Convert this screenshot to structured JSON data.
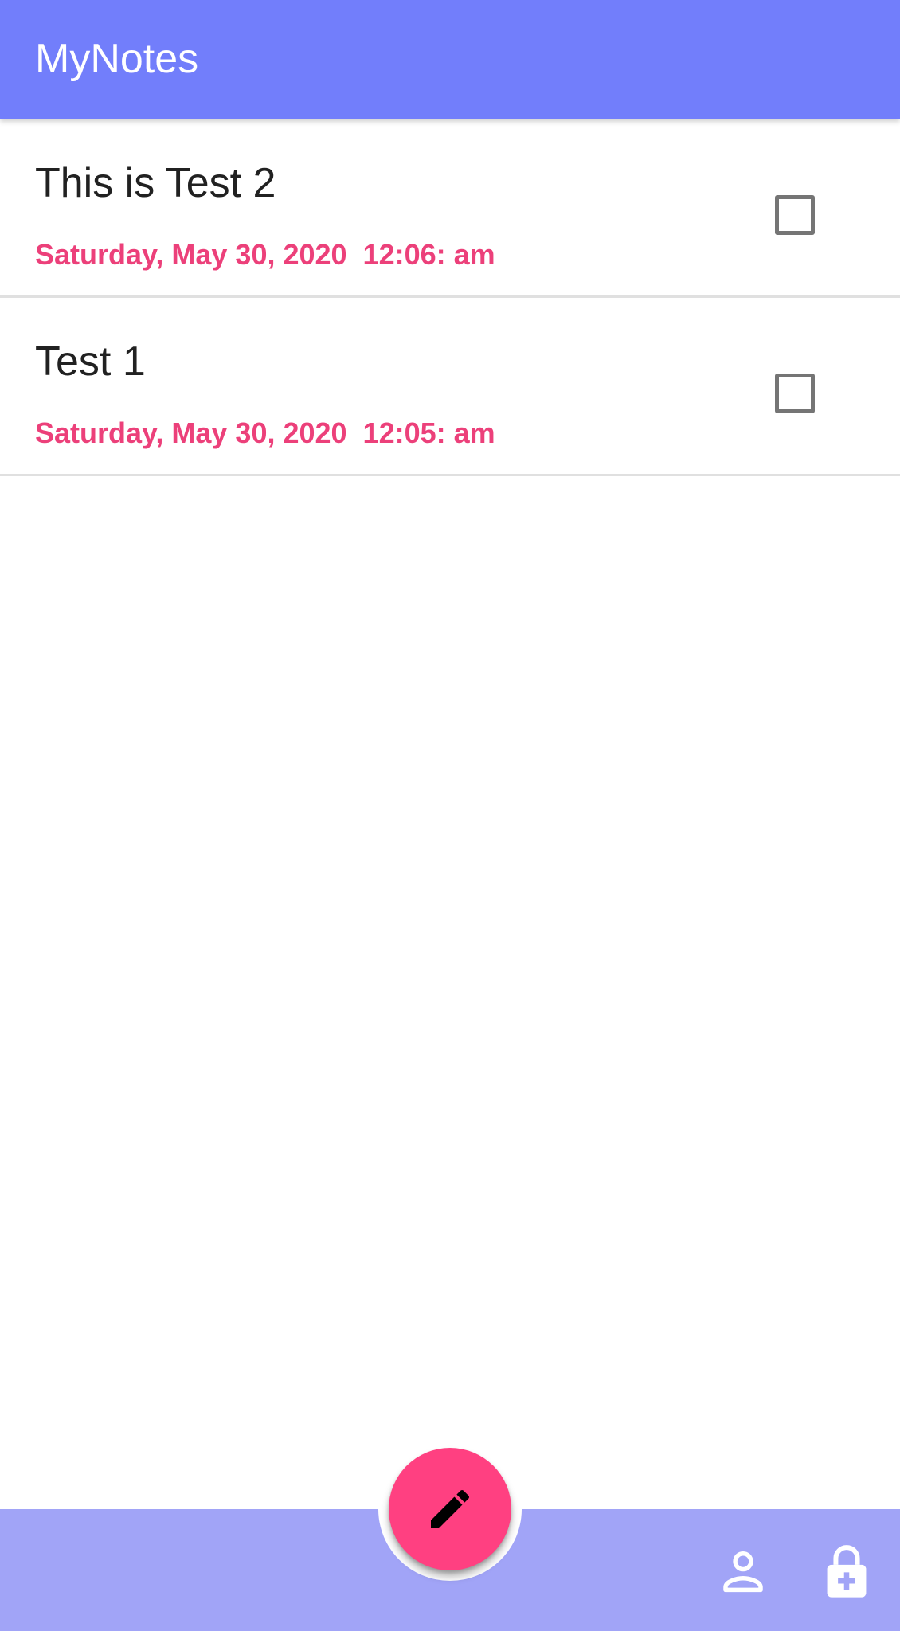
{
  "app_bar": {
    "title": "MyNotes"
  },
  "notes": [
    {
      "title": "This is Test 2",
      "date": "Saturday, May 30, 2020  12:06: am",
      "checked": false
    },
    {
      "title": "Test 1",
      "date": "Saturday, May 30, 2020  12:05: am",
      "checked": false
    }
  ],
  "bottom_bar": {
    "fab_icon": "pencil-icon",
    "actions": [
      {
        "icon": "person-icon"
      },
      {
        "icon": "lock-add-icon"
      }
    ]
  },
  "colors": {
    "app_bar": "#727EFB",
    "bottom_bar": "#A1A4F7",
    "accent": "#FF4081",
    "date_text": "#EC407A"
  }
}
